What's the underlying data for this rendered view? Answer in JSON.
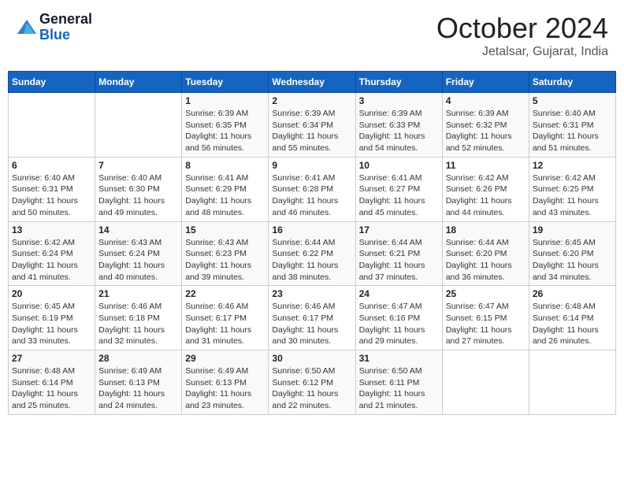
{
  "header": {
    "logo_line1": "General",
    "logo_line2": "Blue",
    "title": "October 2024",
    "subtitle": "Jetalsar, Gujarat, India"
  },
  "days_of_week": [
    "Sunday",
    "Monday",
    "Tuesday",
    "Wednesday",
    "Thursday",
    "Friday",
    "Saturday"
  ],
  "weeks": [
    [
      {
        "day": "",
        "text": ""
      },
      {
        "day": "",
        "text": ""
      },
      {
        "day": "1",
        "text": "Sunrise: 6:39 AM\nSunset: 6:35 PM\nDaylight: 11 hours and 56 minutes."
      },
      {
        "day": "2",
        "text": "Sunrise: 6:39 AM\nSunset: 6:34 PM\nDaylight: 11 hours and 55 minutes."
      },
      {
        "day": "3",
        "text": "Sunrise: 6:39 AM\nSunset: 6:33 PM\nDaylight: 11 hours and 54 minutes."
      },
      {
        "day": "4",
        "text": "Sunrise: 6:39 AM\nSunset: 6:32 PM\nDaylight: 11 hours and 52 minutes."
      },
      {
        "day": "5",
        "text": "Sunrise: 6:40 AM\nSunset: 6:31 PM\nDaylight: 11 hours and 51 minutes."
      }
    ],
    [
      {
        "day": "6",
        "text": "Sunrise: 6:40 AM\nSunset: 6:31 PM\nDaylight: 11 hours and 50 minutes."
      },
      {
        "day": "7",
        "text": "Sunrise: 6:40 AM\nSunset: 6:30 PM\nDaylight: 11 hours and 49 minutes."
      },
      {
        "day": "8",
        "text": "Sunrise: 6:41 AM\nSunset: 6:29 PM\nDaylight: 11 hours and 48 minutes."
      },
      {
        "day": "9",
        "text": "Sunrise: 6:41 AM\nSunset: 6:28 PM\nDaylight: 11 hours and 46 minutes."
      },
      {
        "day": "10",
        "text": "Sunrise: 6:41 AM\nSunset: 6:27 PM\nDaylight: 11 hours and 45 minutes."
      },
      {
        "day": "11",
        "text": "Sunrise: 6:42 AM\nSunset: 6:26 PM\nDaylight: 11 hours and 44 minutes."
      },
      {
        "day": "12",
        "text": "Sunrise: 6:42 AM\nSunset: 6:25 PM\nDaylight: 11 hours and 43 minutes."
      }
    ],
    [
      {
        "day": "13",
        "text": "Sunrise: 6:42 AM\nSunset: 6:24 PM\nDaylight: 11 hours and 41 minutes."
      },
      {
        "day": "14",
        "text": "Sunrise: 6:43 AM\nSunset: 6:24 PM\nDaylight: 11 hours and 40 minutes."
      },
      {
        "day": "15",
        "text": "Sunrise: 6:43 AM\nSunset: 6:23 PM\nDaylight: 11 hours and 39 minutes."
      },
      {
        "day": "16",
        "text": "Sunrise: 6:44 AM\nSunset: 6:22 PM\nDaylight: 11 hours and 38 minutes."
      },
      {
        "day": "17",
        "text": "Sunrise: 6:44 AM\nSunset: 6:21 PM\nDaylight: 11 hours and 37 minutes."
      },
      {
        "day": "18",
        "text": "Sunrise: 6:44 AM\nSunset: 6:20 PM\nDaylight: 11 hours and 36 minutes."
      },
      {
        "day": "19",
        "text": "Sunrise: 6:45 AM\nSunset: 6:20 PM\nDaylight: 11 hours and 34 minutes."
      }
    ],
    [
      {
        "day": "20",
        "text": "Sunrise: 6:45 AM\nSunset: 6:19 PM\nDaylight: 11 hours and 33 minutes."
      },
      {
        "day": "21",
        "text": "Sunrise: 6:46 AM\nSunset: 6:18 PM\nDaylight: 11 hours and 32 minutes."
      },
      {
        "day": "22",
        "text": "Sunrise: 6:46 AM\nSunset: 6:17 PM\nDaylight: 11 hours and 31 minutes."
      },
      {
        "day": "23",
        "text": "Sunrise: 6:46 AM\nSunset: 6:17 PM\nDaylight: 11 hours and 30 minutes."
      },
      {
        "day": "24",
        "text": "Sunrise: 6:47 AM\nSunset: 6:16 PM\nDaylight: 11 hours and 29 minutes."
      },
      {
        "day": "25",
        "text": "Sunrise: 6:47 AM\nSunset: 6:15 PM\nDaylight: 11 hours and 27 minutes."
      },
      {
        "day": "26",
        "text": "Sunrise: 6:48 AM\nSunset: 6:14 PM\nDaylight: 11 hours and 26 minutes."
      }
    ],
    [
      {
        "day": "27",
        "text": "Sunrise: 6:48 AM\nSunset: 6:14 PM\nDaylight: 11 hours and 25 minutes."
      },
      {
        "day": "28",
        "text": "Sunrise: 6:49 AM\nSunset: 6:13 PM\nDaylight: 11 hours and 24 minutes."
      },
      {
        "day": "29",
        "text": "Sunrise: 6:49 AM\nSunset: 6:13 PM\nDaylight: 11 hours and 23 minutes."
      },
      {
        "day": "30",
        "text": "Sunrise: 6:50 AM\nSunset: 6:12 PM\nDaylight: 11 hours and 22 minutes."
      },
      {
        "day": "31",
        "text": "Sunrise: 6:50 AM\nSunset: 6:11 PM\nDaylight: 11 hours and 21 minutes."
      },
      {
        "day": "",
        "text": ""
      },
      {
        "day": "",
        "text": ""
      }
    ]
  ]
}
